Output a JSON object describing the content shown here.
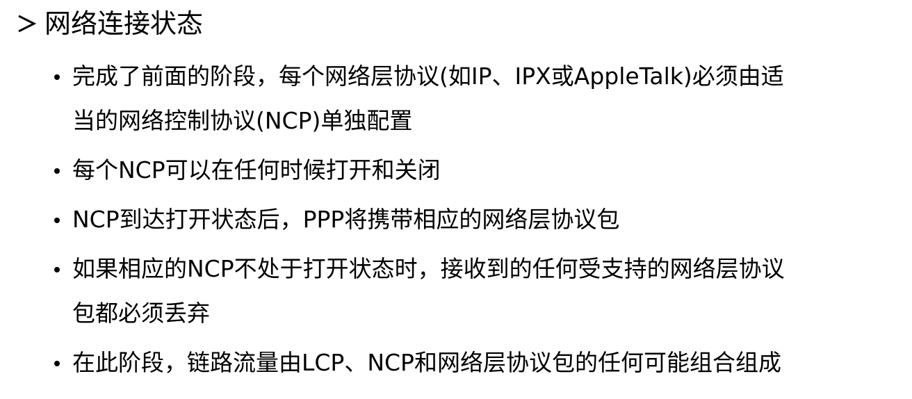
{
  "heading": {
    "text": "网络连接状态",
    "marker_icon": "arrow-bullet-icon"
  },
  "bullets": [
    {
      "lines": [
        "完成了前面的阶段，每个网络层协议(如IP、IPX或AppleTalk)必须由适",
        "当的网络控制协议(NCP)单独配置"
      ]
    },
    {
      "lines": [
        "每个NCP可以在任何时候打开和关闭"
      ]
    },
    {
      "lines": [
        "NCP到达打开状态后，PPP将携带相应的网络层协议包"
      ]
    },
    {
      "lines": [
        "如果相应的NCP不处于打开状态时，接收到的任何受支持的网络层协议",
        "包都必须丢弃"
      ]
    },
    {
      "lines": [
        "在此阶段，链路流量由LCP、NCP和网络层协议包的任何可能组合组成"
      ]
    }
  ]
}
